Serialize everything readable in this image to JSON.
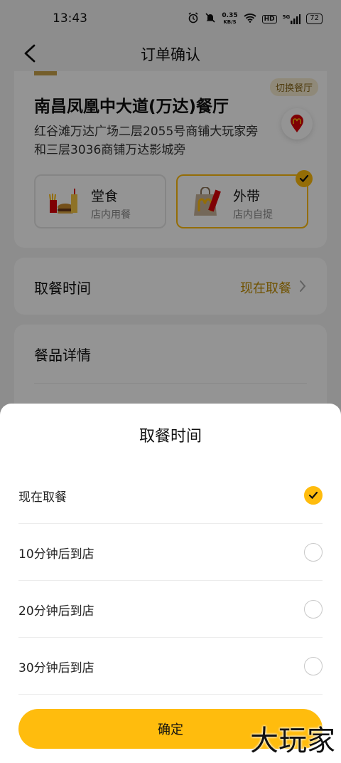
{
  "status": {
    "time": "13:43",
    "net_speed_value": "0.35",
    "net_speed_unit": "KB/S",
    "hd": "HD",
    "signal_label": "5G",
    "battery": "72"
  },
  "nav": {
    "title": "订单确认"
  },
  "store": {
    "name": "南昌凤凰中大道(万达)餐厅",
    "address": "红谷滩万达广场二层2055号商铺大玩家旁和三层3036商铺万达影城旁",
    "switch_label": "切换餐厅"
  },
  "modes": [
    {
      "title": "堂食",
      "subtitle": "店内用餐",
      "selected": false
    },
    {
      "title": "外带",
      "subtitle": "店内自提",
      "selected": true
    }
  ],
  "pickup": {
    "label": "取餐时间",
    "value": "现在取餐"
  },
  "detail": {
    "label": "餐品详情"
  },
  "sheet": {
    "title": "取餐时间",
    "options": [
      {
        "label": "现在取餐",
        "selected": true
      },
      {
        "label": "10分钟后到店",
        "selected": false
      },
      {
        "label": "20分钟后到店",
        "selected": false
      },
      {
        "label": "30分钟后到店",
        "selected": false
      }
    ],
    "confirm_label": "确定"
  },
  "watermark": "大玩家",
  "colors": {
    "accent": "#ffbc0d",
    "accent_text": "#c28d00",
    "brand_red": "#db0007"
  }
}
